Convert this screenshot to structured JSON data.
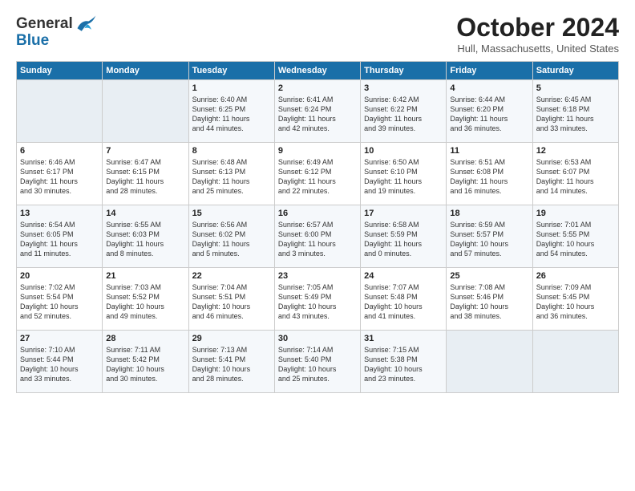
{
  "header": {
    "logo_line1": "General",
    "logo_line2": "Blue",
    "month_title": "October 2024",
    "location": "Hull, Massachusetts, United States"
  },
  "weekdays": [
    "Sunday",
    "Monday",
    "Tuesday",
    "Wednesday",
    "Thursday",
    "Friday",
    "Saturday"
  ],
  "weeks": [
    [
      {
        "day": "",
        "info": ""
      },
      {
        "day": "",
        "info": ""
      },
      {
        "day": "1",
        "info": "Sunrise: 6:40 AM\nSunset: 6:25 PM\nDaylight: 11 hours\nand 44 minutes."
      },
      {
        "day": "2",
        "info": "Sunrise: 6:41 AM\nSunset: 6:24 PM\nDaylight: 11 hours\nand 42 minutes."
      },
      {
        "day": "3",
        "info": "Sunrise: 6:42 AM\nSunset: 6:22 PM\nDaylight: 11 hours\nand 39 minutes."
      },
      {
        "day": "4",
        "info": "Sunrise: 6:44 AM\nSunset: 6:20 PM\nDaylight: 11 hours\nand 36 minutes."
      },
      {
        "day": "5",
        "info": "Sunrise: 6:45 AM\nSunset: 6:18 PM\nDaylight: 11 hours\nand 33 minutes."
      }
    ],
    [
      {
        "day": "6",
        "info": "Sunrise: 6:46 AM\nSunset: 6:17 PM\nDaylight: 11 hours\nand 30 minutes."
      },
      {
        "day": "7",
        "info": "Sunrise: 6:47 AM\nSunset: 6:15 PM\nDaylight: 11 hours\nand 28 minutes."
      },
      {
        "day": "8",
        "info": "Sunrise: 6:48 AM\nSunset: 6:13 PM\nDaylight: 11 hours\nand 25 minutes."
      },
      {
        "day": "9",
        "info": "Sunrise: 6:49 AM\nSunset: 6:12 PM\nDaylight: 11 hours\nand 22 minutes."
      },
      {
        "day": "10",
        "info": "Sunrise: 6:50 AM\nSunset: 6:10 PM\nDaylight: 11 hours\nand 19 minutes."
      },
      {
        "day": "11",
        "info": "Sunrise: 6:51 AM\nSunset: 6:08 PM\nDaylight: 11 hours\nand 16 minutes."
      },
      {
        "day": "12",
        "info": "Sunrise: 6:53 AM\nSunset: 6:07 PM\nDaylight: 11 hours\nand 14 minutes."
      }
    ],
    [
      {
        "day": "13",
        "info": "Sunrise: 6:54 AM\nSunset: 6:05 PM\nDaylight: 11 hours\nand 11 minutes."
      },
      {
        "day": "14",
        "info": "Sunrise: 6:55 AM\nSunset: 6:03 PM\nDaylight: 11 hours\nand 8 minutes."
      },
      {
        "day": "15",
        "info": "Sunrise: 6:56 AM\nSunset: 6:02 PM\nDaylight: 11 hours\nand 5 minutes."
      },
      {
        "day": "16",
        "info": "Sunrise: 6:57 AM\nSunset: 6:00 PM\nDaylight: 11 hours\nand 3 minutes."
      },
      {
        "day": "17",
        "info": "Sunrise: 6:58 AM\nSunset: 5:59 PM\nDaylight: 11 hours\nand 0 minutes."
      },
      {
        "day": "18",
        "info": "Sunrise: 6:59 AM\nSunset: 5:57 PM\nDaylight: 10 hours\nand 57 minutes."
      },
      {
        "day": "19",
        "info": "Sunrise: 7:01 AM\nSunset: 5:55 PM\nDaylight: 10 hours\nand 54 minutes."
      }
    ],
    [
      {
        "day": "20",
        "info": "Sunrise: 7:02 AM\nSunset: 5:54 PM\nDaylight: 10 hours\nand 52 minutes."
      },
      {
        "day": "21",
        "info": "Sunrise: 7:03 AM\nSunset: 5:52 PM\nDaylight: 10 hours\nand 49 minutes."
      },
      {
        "day": "22",
        "info": "Sunrise: 7:04 AM\nSunset: 5:51 PM\nDaylight: 10 hours\nand 46 minutes."
      },
      {
        "day": "23",
        "info": "Sunrise: 7:05 AM\nSunset: 5:49 PM\nDaylight: 10 hours\nand 43 minutes."
      },
      {
        "day": "24",
        "info": "Sunrise: 7:07 AM\nSunset: 5:48 PM\nDaylight: 10 hours\nand 41 minutes."
      },
      {
        "day": "25",
        "info": "Sunrise: 7:08 AM\nSunset: 5:46 PM\nDaylight: 10 hours\nand 38 minutes."
      },
      {
        "day": "26",
        "info": "Sunrise: 7:09 AM\nSunset: 5:45 PM\nDaylight: 10 hours\nand 36 minutes."
      }
    ],
    [
      {
        "day": "27",
        "info": "Sunrise: 7:10 AM\nSunset: 5:44 PM\nDaylight: 10 hours\nand 33 minutes."
      },
      {
        "day": "28",
        "info": "Sunrise: 7:11 AM\nSunset: 5:42 PM\nDaylight: 10 hours\nand 30 minutes."
      },
      {
        "day": "29",
        "info": "Sunrise: 7:13 AM\nSunset: 5:41 PM\nDaylight: 10 hours\nand 28 minutes."
      },
      {
        "day": "30",
        "info": "Sunrise: 7:14 AM\nSunset: 5:40 PM\nDaylight: 10 hours\nand 25 minutes."
      },
      {
        "day": "31",
        "info": "Sunrise: 7:15 AM\nSunset: 5:38 PM\nDaylight: 10 hours\nand 23 minutes."
      },
      {
        "day": "",
        "info": ""
      },
      {
        "day": "",
        "info": ""
      }
    ]
  ]
}
